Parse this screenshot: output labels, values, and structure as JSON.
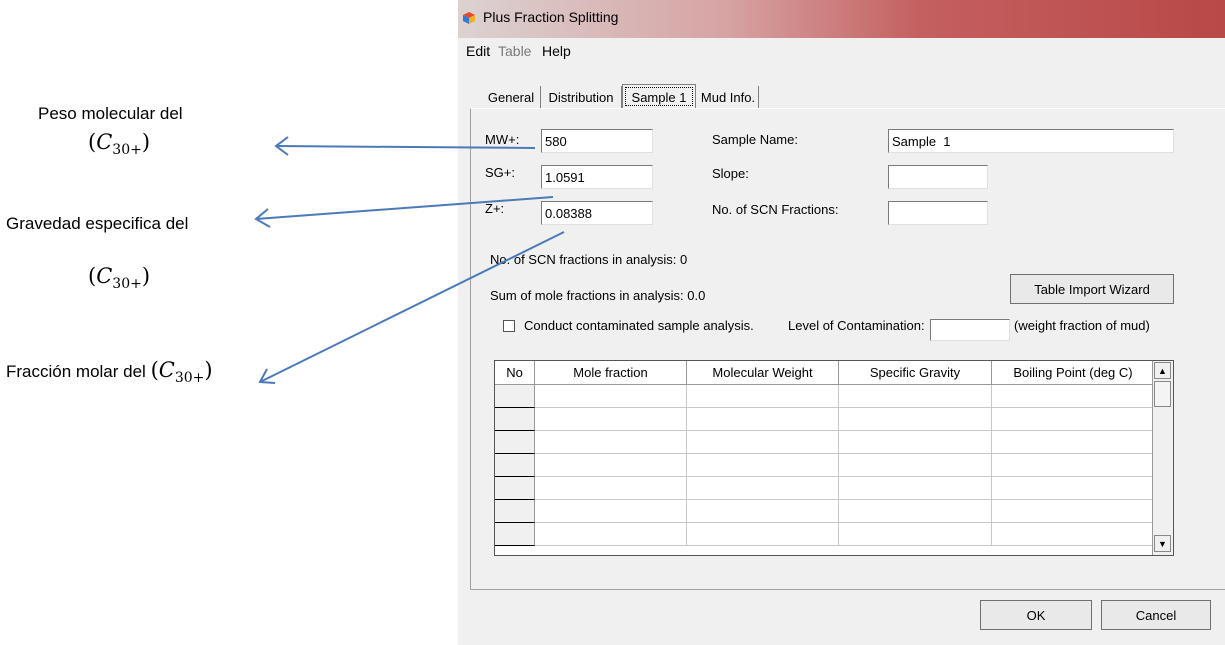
{
  "annotations": {
    "mw_text": "Peso molecular del",
    "sg_text": "Gravedad especifica del",
    "z_text": "Fracción molar del",
    "formula_sym": "C",
    "formula_sub": "30+"
  },
  "window": {
    "title": "Plus Fraction Splitting",
    "menu": [
      "Edit",
      "Table",
      "Help"
    ]
  },
  "tabs": [
    "General",
    "Distribution",
    "Sample 1",
    "Mud Info."
  ],
  "form": {
    "mw_label": "MW+:",
    "mw_value": "580",
    "sg_label": "SG+:",
    "sg_value": "1.0591",
    "z_label": "Z+:",
    "z_value": "0.08388",
    "sample_name_label": "Sample Name:",
    "sample_name_value": "Sample  1",
    "slope_label": "Slope:",
    "slope_value": "",
    "scn_label": "No. of SCN Fractions:",
    "scn_value": ""
  },
  "info": {
    "scn_in_analysis": "No. of SCN fractions in analysis: 0",
    "sum_mole": "Sum of mole fractions in analysis: 0.0"
  },
  "import_button": "Table Import Wizard",
  "contamination": {
    "checkbox_label": "Conduct contaminated sample analysis.",
    "level_label": "Level of Contamination:",
    "level_value": "",
    "unit": "(weight fraction of mud)"
  },
  "table": {
    "columns": [
      "No",
      "Mole fraction",
      "Molecular Weight",
      "Specific Gravity",
      "Boiling Point (deg C)"
    ]
  },
  "buttons": {
    "ok": "OK",
    "cancel": "Cancel"
  },
  "colors": {
    "arrow": "#4a7ab8",
    "titlebar_end": "#b94848"
  }
}
